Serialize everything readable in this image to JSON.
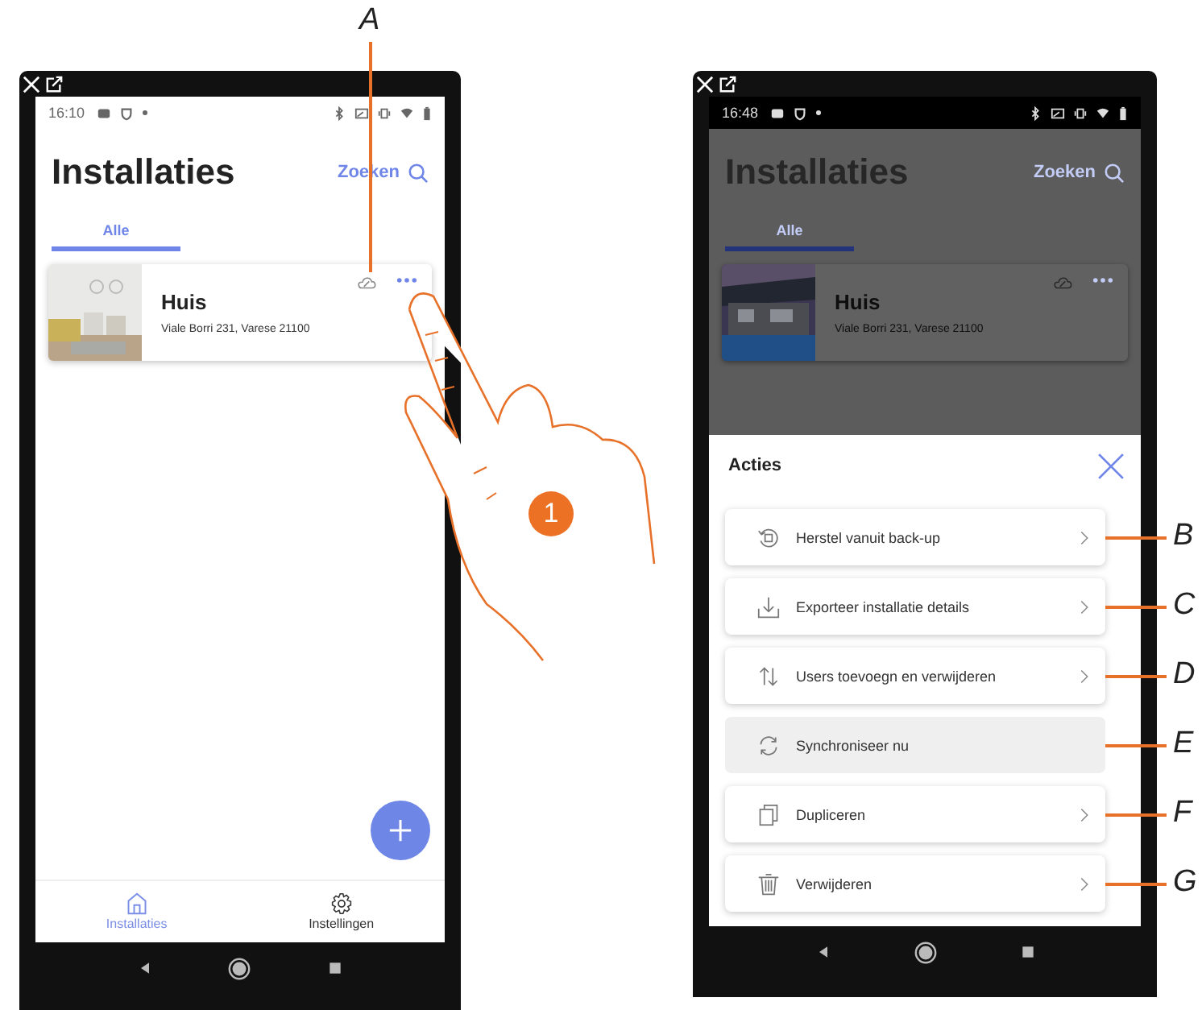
{
  "phones": [
    {
      "status_time": "16:10",
      "dimmed": false,
      "title": "Installaties",
      "search_label": "Zoeken",
      "tabs": [
        {
          "label": "Alle",
          "selected": true
        }
      ],
      "card": {
        "kind": "picture",
        "name": "Huis",
        "address": "Viale Borri 231, Varese 21100",
        "callout": "A"
      },
      "fab": true,
      "bottom_nav": [
        {
          "label": "Installaties",
          "kind": "home",
          "selected": true
        },
        {
          "label": "Instellingen",
          "kind": "settings",
          "selected": false
        }
      ]
    },
    {
      "status_time": "16:48",
      "dimmed": true,
      "title": "Installaties",
      "search_label": "Zoeken",
      "tabs": [
        {
          "label": "Alle",
          "selected": true
        }
      ],
      "card": {
        "kind": "picture",
        "name": "Huis",
        "address": "Viale Borri 231, Varese 21100"
      },
      "fab": false,
      "sheet": {
        "title": "Acties",
        "actions": [
          {
            "label": "Herstel vanuit back-up",
            "kind": "restore",
            "disabled": false,
            "callout": "B"
          },
          {
            "label": "Exporteer installatie details",
            "kind": "export",
            "disabled": false,
            "callout": "C"
          },
          {
            "label": "Users toevoegn en verwijderen",
            "kind": "users",
            "disabled": false,
            "callout": "D"
          },
          {
            "label": "Synchroniseer nu",
            "kind": "sync",
            "disabled": true,
            "callout": "E"
          },
          {
            "label": "Dupliceren",
            "kind": "duplicate",
            "disabled": false,
            "callout": "F"
          },
          {
            "label": "Verwijderen",
            "kind": "delete",
            "disabled": false,
            "callout": "G"
          }
        ]
      }
    }
  ],
  "step_badge": "1"
}
